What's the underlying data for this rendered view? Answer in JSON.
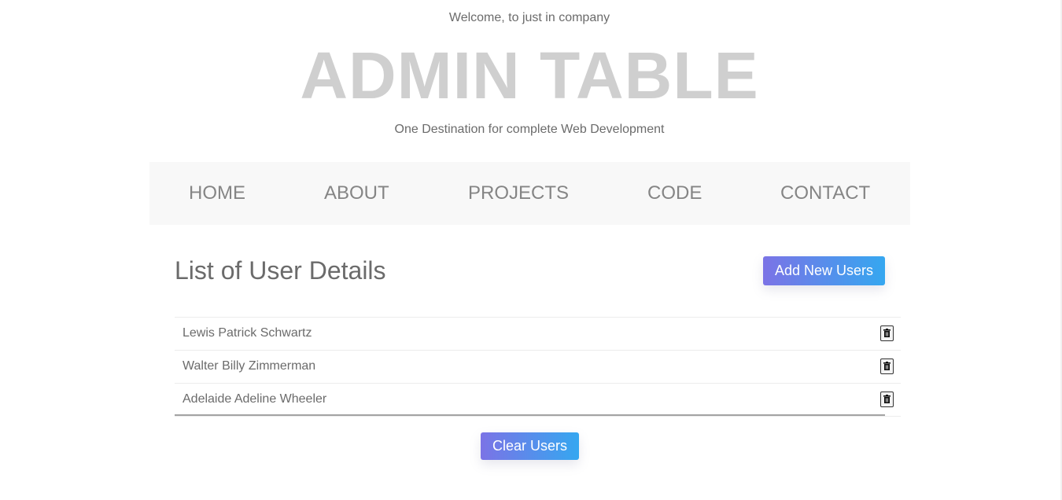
{
  "header": {
    "welcome": "Welcome, to just in company",
    "title": "ADMIN TABLE",
    "subtitle": "One Destination for complete Web Development"
  },
  "nav": {
    "items": [
      {
        "label": "HOME"
      },
      {
        "label": "ABOUT"
      },
      {
        "label": "PROJECTS"
      },
      {
        "label": "CODE"
      },
      {
        "label": "CONTACT"
      }
    ]
  },
  "main": {
    "heading": "List of User Details",
    "add_button": "Add New Users",
    "clear_button": "Clear Users",
    "users": [
      {
        "name": "Lewis Patrick Schwartz",
        "action_icon": "trash-icon"
      },
      {
        "name": "Walter Billy Zimmerman",
        "action_icon": "trash-icon"
      },
      {
        "name": "Adelaide Adeline Wheeler",
        "action_icon": "trash-icon"
      }
    ]
  },
  "colors": {
    "title": "#cfcfcf",
    "text": "#6b6b6b",
    "nav_text": "#858585",
    "nav_bg": "#f8f8f8",
    "button_gradient_start": "#7b73e6",
    "button_gradient_end": "#35a7f0"
  }
}
